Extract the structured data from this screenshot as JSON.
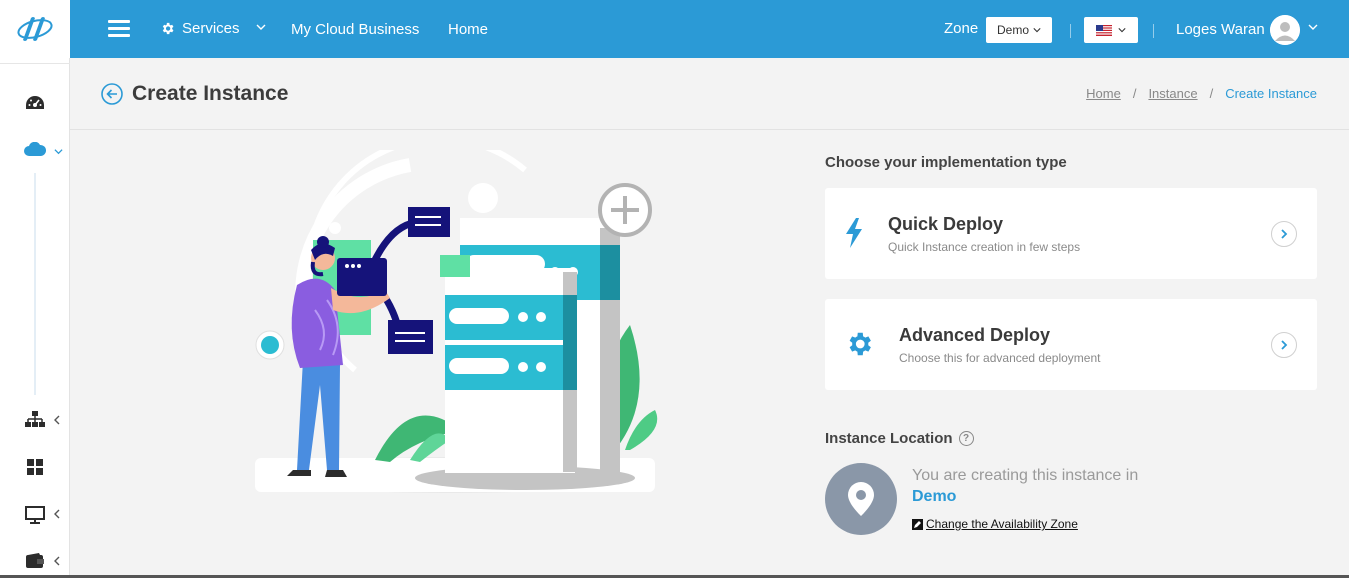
{
  "topbar": {
    "services_label": "Services",
    "nav_links": [
      "My Cloud Business",
      "Home"
    ],
    "zone_label": "Zone",
    "zone_value": "Demo",
    "user_name": "Loges Waran"
  },
  "page": {
    "title": "Create Instance",
    "breadcrumb": [
      "Home",
      "Instance",
      "Create Instance"
    ]
  },
  "implementation": {
    "heading": "Choose your implementation type",
    "options": [
      {
        "title": "Quick Deploy",
        "subtitle": "Quick Instance creation in few steps",
        "icon": "lightning-icon"
      },
      {
        "title": "Advanced Deploy",
        "subtitle": "Choose this for advanced deployment",
        "icon": "gear-icon"
      }
    ]
  },
  "location": {
    "heading": "Instance Location",
    "text": "You are creating this instance in",
    "zone": "Demo",
    "change_link": "Change the Availability Zone"
  },
  "colors": {
    "primary": "#2b9ad6",
    "background": "#f3f3f3",
    "teal": "#2bbcd2",
    "navy": "#15137a"
  }
}
